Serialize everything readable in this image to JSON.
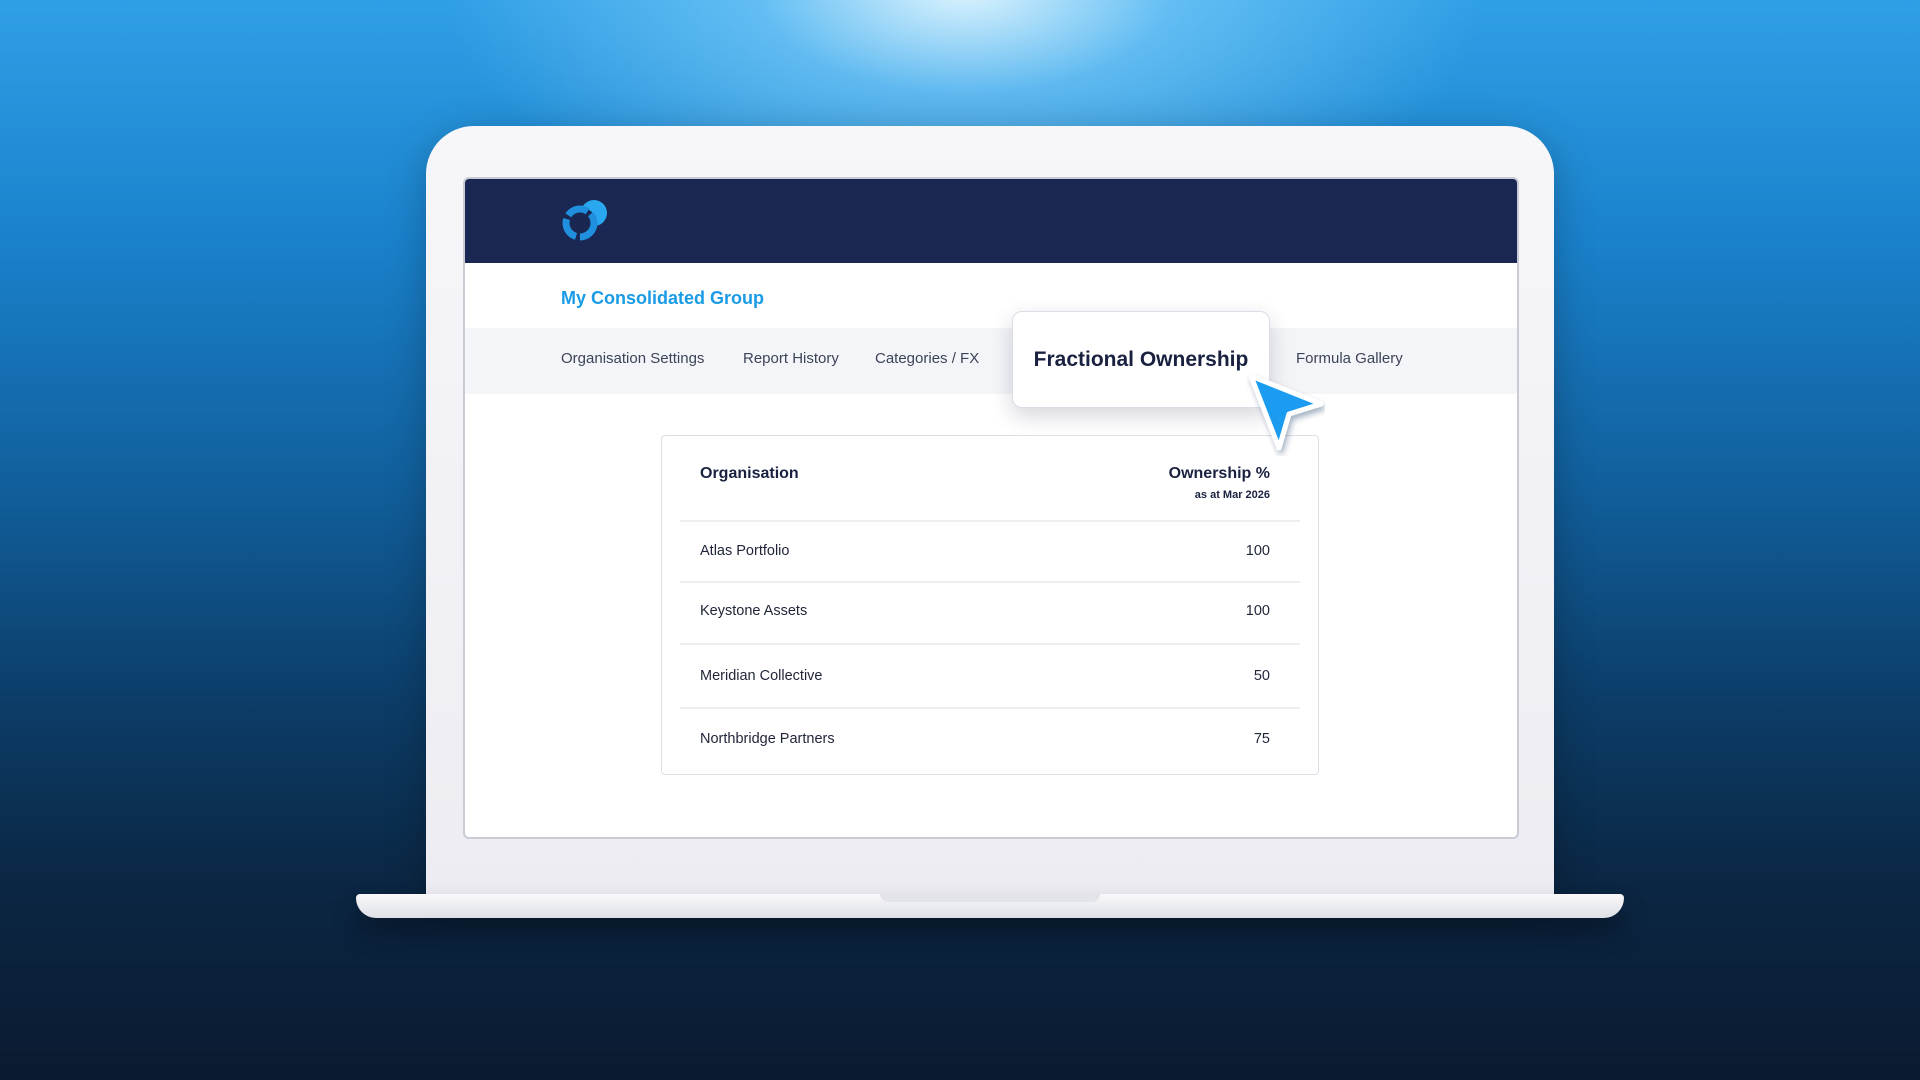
{
  "app": {
    "group_title": "My Consolidated Group"
  },
  "tabs": [
    {
      "label": "Organisation Settings",
      "active": false
    },
    {
      "label": "Report History",
      "active": false
    },
    {
      "label": "Categories / FX",
      "active": false
    },
    {
      "label": "Fractional Ownership",
      "active": true
    },
    {
      "label": "Formula Gallery",
      "active": false
    }
  ],
  "table": {
    "header_org": "Organisation",
    "header_ownership": "Ownership %",
    "header_ownership_sub": "as at Mar 2026",
    "rows": [
      {
        "organisation": "Atlas Portfolio",
        "ownership": "100"
      },
      {
        "organisation": "Keystone Assets",
        "ownership": "100"
      },
      {
        "organisation": "Meridian Collective",
        "ownership": "50"
      },
      {
        "organisation": "Northbridge Partners",
        "ownership": "75"
      }
    ]
  },
  "icons": {
    "logo": "app-logo-icon",
    "cursor": "pointer-cursor-icon"
  },
  "colors": {
    "topbar": "#1a2752",
    "accent": "#1a9be6",
    "cursor": "#1e9cf0"
  }
}
